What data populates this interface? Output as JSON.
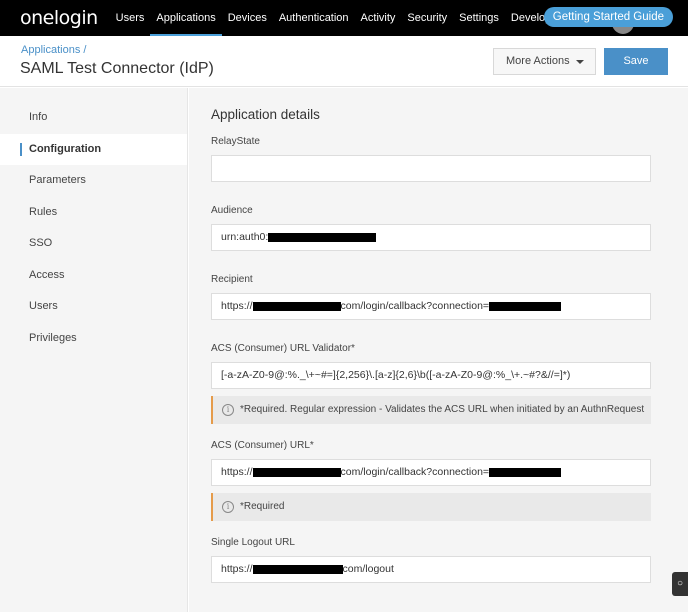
{
  "topnav": {
    "logo": "onelogin",
    "items": [
      "Users",
      "Applications",
      "Devices",
      "Authentication",
      "Activity",
      "Security",
      "Settings",
      "Developers"
    ],
    "active": "Applications",
    "guide": "Getting Started Guide"
  },
  "header": {
    "breadcrumb": "Applications /",
    "title": "SAML Test Connector (IdP)",
    "more_actions": "More Actions",
    "save": "Save"
  },
  "sidebar": {
    "items": [
      {
        "label": "Info"
      },
      {
        "label": "Configuration"
      },
      {
        "label": "Parameters"
      },
      {
        "label": "Rules"
      },
      {
        "label": "SSO"
      },
      {
        "label": "Access"
      },
      {
        "label": "Users"
      },
      {
        "label": "Privileges"
      }
    ],
    "active": "Configuration"
  },
  "main": {
    "heading": "Application details",
    "relaystate": {
      "label": "RelayState",
      "value": ""
    },
    "audience": {
      "label": "Audience",
      "prefix": "urn:auth0:"
    },
    "recipient": {
      "label": "Recipient",
      "prefix": "https://",
      "middle": "com/login/callback?connection="
    },
    "validator": {
      "label": "ACS (Consumer) URL Validator*",
      "value": "[-a-zA-Z0-9@:%._\\+~#=]{2,256}\\.[a-z]{2,6}\\b([-a-zA-Z0-9@:%_\\+.~#?&//=]*)",
      "note": "*Required. Regular expression - Validates the ACS URL when initiated by an AuthnRequest"
    },
    "acs_url": {
      "label": "ACS (Consumer) URL*",
      "prefix": "https://",
      "middle": "com/login/callback?connection=",
      "note": "*Required"
    },
    "logout": {
      "label": "Single Logout URL",
      "prefix": "https://",
      "suffix": "com/logout"
    }
  },
  "colors": {
    "accent": "#4a90c8",
    "note_border": "#e59b4a"
  }
}
